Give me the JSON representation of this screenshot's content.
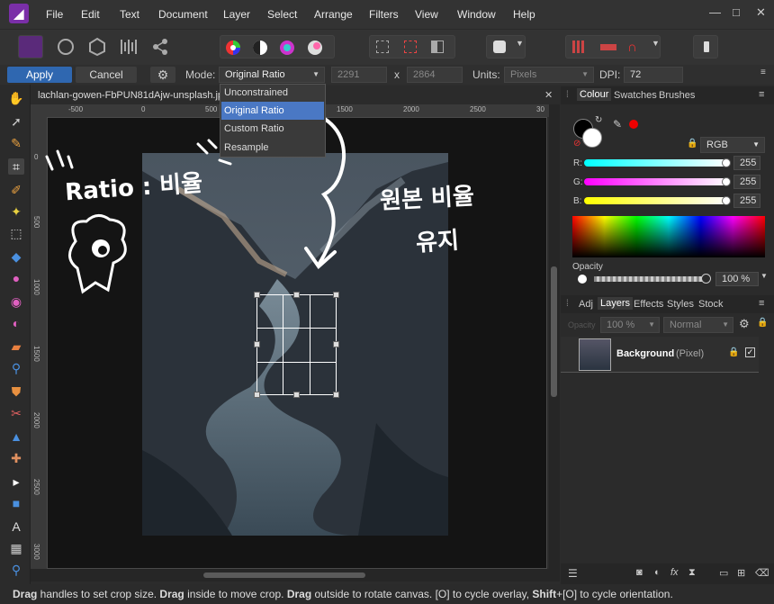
{
  "menu": {
    "items": [
      "File",
      "Edit",
      "Text",
      "Document",
      "Layer",
      "Select",
      "Arrange",
      "Filters",
      "View",
      "Window",
      "Help"
    ]
  },
  "window": {
    "minimize": "—",
    "maximize": "□",
    "close": "✕"
  },
  "context": {
    "apply": "Apply",
    "cancel": "Cancel",
    "mode_label": "Mode:",
    "mode_value": "Original Ratio",
    "width": "2291",
    "x": "x",
    "height": "2864",
    "units_label": "Units:",
    "units_value": "Pixels",
    "dpi_label": "DPI:",
    "dpi_value": "72"
  },
  "dropdown": {
    "options": [
      "Unconstrained",
      "Original Ratio",
      "Custom Ratio",
      "Resample"
    ],
    "selected": "Original Ratio"
  },
  "document": {
    "tab_title": "lachlan-gowen-FbPUN81dAjw-unsplash.jpg (1"
  },
  "ruler_h": [
    "-500",
    "0",
    "500",
    "1000",
    "1500",
    "2000",
    "2500",
    "30"
  ],
  "ruler_v": [
    "0",
    "500",
    "1000",
    "1500",
    "2000",
    "2500",
    "3000"
  ],
  "colour_panel": {
    "tabs": [
      "Colour",
      "Swatches",
      "Brushes"
    ],
    "model": "RGB",
    "r_label": "R:",
    "g_label": "G:",
    "b_label": "B:",
    "r": "255",
    "g": "255",
    "b": "255",
    "opacity_label": "Opacity",
    "opacity_value": "100 %"
  },
  "layers_panel": {
    "tabs": [
      "Adj",
      "Layers",
      "Effects",
      "Styles",
      "Stock"
    ],
    "opacity_label": "Opacity",
    "opacity_value": "100 %",
    "blend": "Normal",
    "layer_name": "Background",
    "layer_type": "(Pixel)"
  },
  "status": {
    "b1": "Drag",
    "t1": " handles to set crop size. ",
    "b2": "Drag",
    "t2": " inside to move crop. ",
    "b3": "Drag",
    "t3": " outside to rotate canvas. [O] to cycle overlay, ",
    "b4": "Shift",
    "t4": "+[O] to cycle orientation."
  },
  "annotations": {
    "left1": "Ratio : 비율",
    "right1": "원본 비율",
    "right2": "유지"
  },
  "colors": {
    "accent": "#2f67b0",
    "brand": "#7a2fa8",
    "selection": "#4a78c4"
  }
}
